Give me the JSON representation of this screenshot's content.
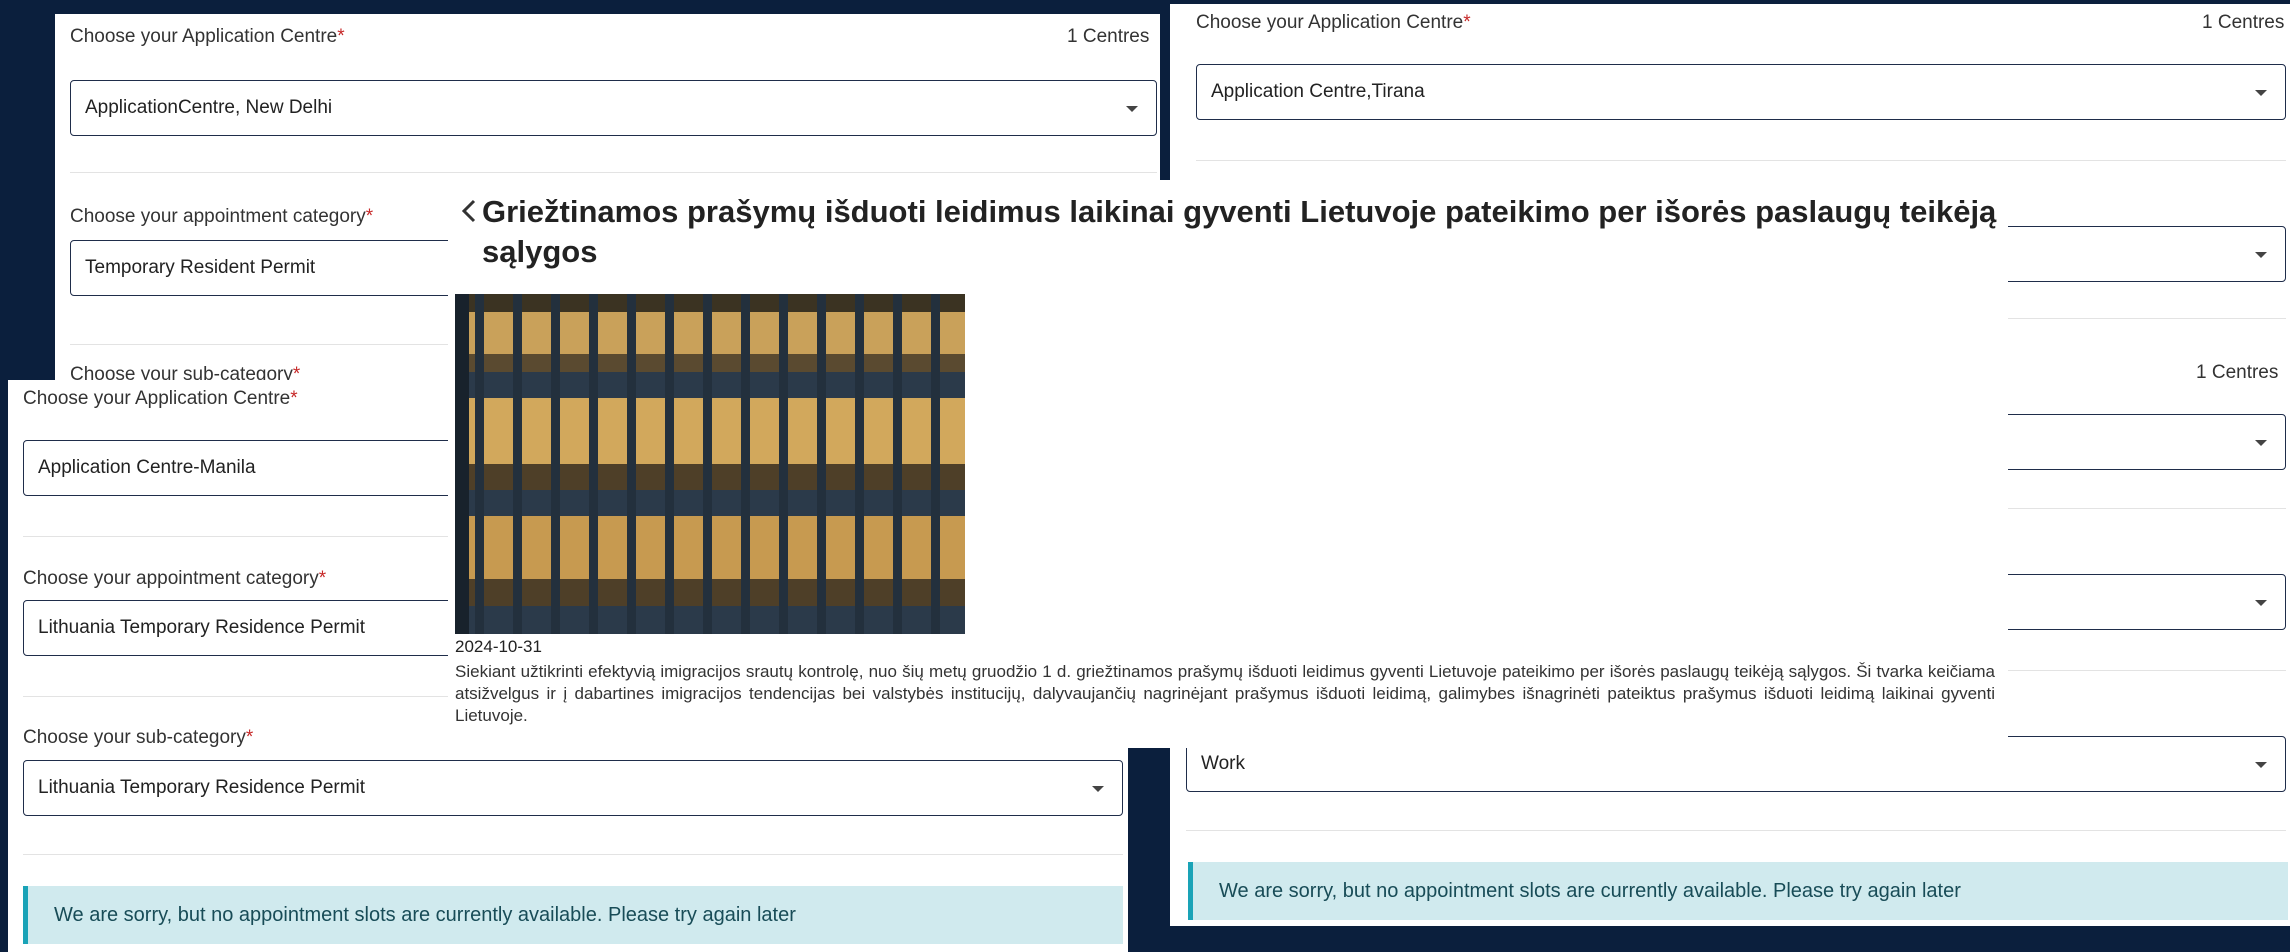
{
  "panel_top_left": {
    "centre_label": "Choose your Application Centre",
    "centre_count": "1 Centres",
    "centre_value": "ApplicationCentre, New Delhi",
    "category_label": "Choose your appointment category",
    "category_value": "Temporary Resident Permit",
    "subcategory_label": "Choose your sub-category"
  },
  "panel_right": {
    "centre_label": "Choose your Application Centre",
    "centre_count": "1 Centres",
    "centre_value": "Application Centre,Tirana",
    "count_2": "1 Centres",
    "subcategory_value": "Work",
    "alert": "We are sorry, but no appointment slots are currently available. Please try again later"
  },
  "panel_bottom_left": {
    "centre_label": "Choose your Application Centre",
    "centre_value": "Application Centre-Manila",
    "category_label": "Choose your appointment category",
    "category_value": "Lithuania Temporary Residence Permit",
    "subcategory_label": "Choose your sub-category",
    "subcategory_value": "Lithuania Temporary Residence Permit",
    "alert": "We are sorry, but no appointment slots are currently available. Please try again later"
  },
  "required_marker": "*",
  "article": {
    "back_icon": "chevron-left-icon",
    "title": "Griežtinamos prašymų išduoti leidimus laikinai gyventi Lietuvoje pateikimo per išorės paslaugų teikėją sąlygos",
    "date": "2024-10-31",
    "body": "Siekiant užtikrinti efektyvią imigracijos srautų kontrolę, nuo šių metų gruodžio 1 d. griežtinamos prašymų išduoti leidimus gyventi Lietuvoje pateikimo per išorės paslaugų teikėją sąlygos. Ši tvarka keičiama atsižvelgus ir į dabartines imigracijos tendencijas bei valstybės institucijų, dalyvaujančių nagrinėjant prašymus išduoti leidimą, galimybes išnagrinėti pateiktus prašymus išduoti leidimą laikinai gyventi Lietuvoje."
  },
  "colors": {
    "background": "#0b1f3d",
    "required": "#c62828",
    "alert_bg": "#d0eaee",
    "alert_border": "#1aa3b7"
  }
}
